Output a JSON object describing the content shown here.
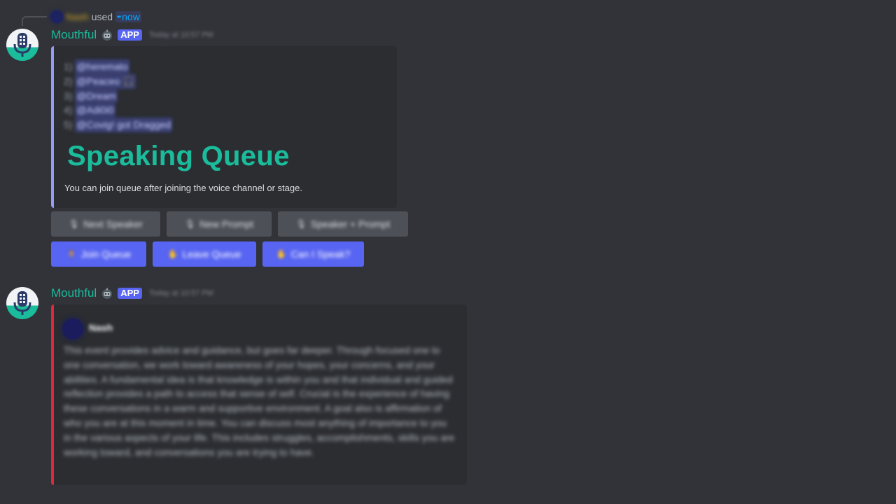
{
  "reply": {
    "user_name": "Nash",
    "used_text": "used",
    "command_label": "now",
    "command_icon": "apps-icon"
  },
  "messages": [
    {
      "username": "Mouthful",
      "tag": "APP",
      "timestamp": "Today at 10:57 PM"
    },
    {
      "username": "Mouthful",
      "tag": "APP",
      "timestamp": "Today at 10:57 PM"
    }
  ],
  "queue_embed": {
    "bar_color": "#949cf7",
    "items": [
      {
        "num": "1)",
        "name": "@heremato"
      },
      {
        "num": "2)",
        "name": "@Peaceo 🎧"
      },
      {
        "num": "3)",
        "name": "@Dream"
      },
      {
        "num": "4)",
        "name": "@Adi0i0"
      },
      {
        "num": "5)",
        "name": "@Covig! got Dragged"
      }
    ],
    "title": "Speaking Queue",
    "description": "You can join queue after joining the voice channel or stage."
  },
  "buttons_row1": [
    {
      "emoji": "🎙",
      "label": "Next Speaker"
    },
    {
      "emoji": "🎙",
      "label": "New Prompt"
    },
    {
      "emoji": "🎙",
      "label": "Speaker + Prompt"
    }
  ],
  "buttons_row2": [
    {
      "emoji": "🧍",
      "label": "Join Queue"
    },
    {
      "emoji": "✋",
      "label": "Leave Queue"
    },
    {
      "emoji": "✋",
      "label": "Can I Speak?"
    }
  ],
  "info_embed": {
    "bar_color": "#e0283c",
    "author": "Nash",
    "description": "This event provides advice and guidance, but goes far deeper. Through focused one to one conversation, we work toward awareness of your hopes, your concerns, and your abilities. A fundamental idea is that knowledge is within you and that individual and guided reflection provides a path to access that sense of self. Crucial is the experience of having these conversations in a warm and supportive environment. A goal also is affirmation of who you are at this moment in time. You can discuss most anything of importance to you in the various aspects of your life. This includes struggles, accomplishments, skills you are working toward, and conversations you are trying to have."
  },
  "colors": {
    "background": "#313338",
    "embed_bg": "#2b2d31",
    "accent_teal": "#1abc9c",
    "blurple": "#5865f2",
    "grey_button": "#4e5058"
  }
}
